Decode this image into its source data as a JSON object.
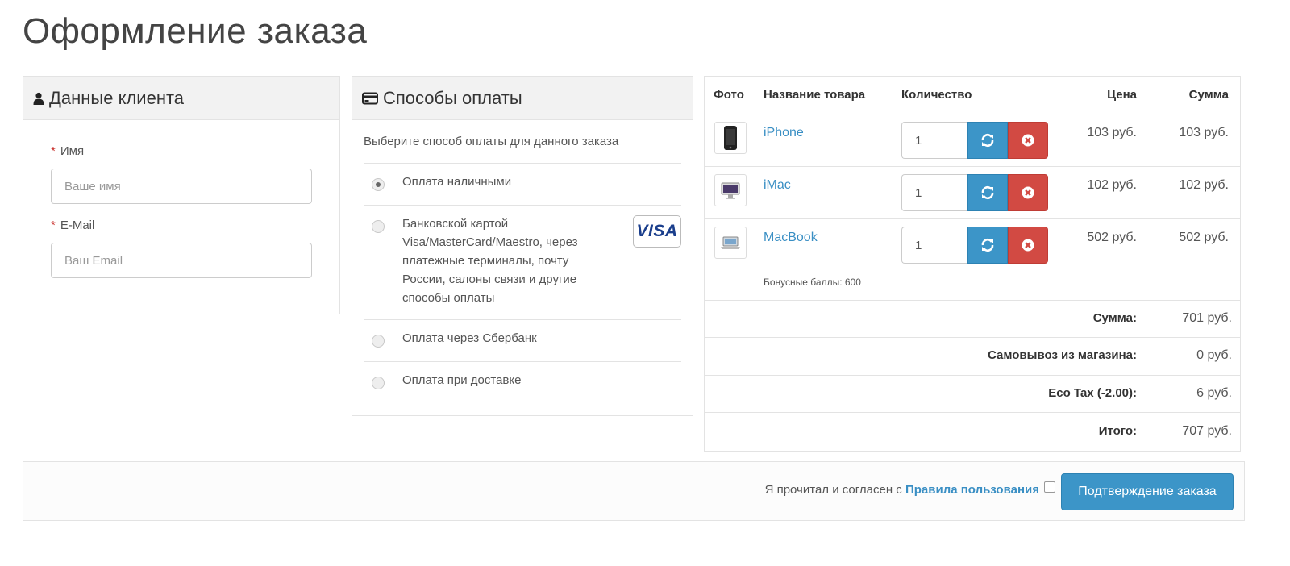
{
  "page": {
    "title": "Оформление заказа"
  },
  "customer": {
    "heading": "Данные клиента",
    "name_label": "Имя",
    "name_placeholder": "Ваше имя",
    "email_label": "E-Mail",
    "email_placeholder": "Ваш Email",
    "required_mark": "*"
  },
  "payment": {
    "heading": "Способы оплаты",
    "hint": "Выберите способ оплаты для данного заказа",
    "options": [
      {
        "label": "Оплата наличными",
        "selected": true
      },
      {
        "label": "Банковской картой Visa/MasterCard/Maestro, через платежные терминалы, почту России, салоны связи и другие способы оплаты",
        "selected": false,
        "badge": "VISA"
      },
      {
        "label": "Оплата через Сбербанк",
        "selected": false
      },
      {
        "label": "Оплата при доставке",
        "selected": false
      }
    ]
  },
  "cart": {
    "headers": {
      "photo": "Фото",
      "name": "Название товара",
      "qty": "Количество",
      "price": "Цена",
      "sum": "Сумма"
    },
    "items": [
      {
        "name": "iPhone",
        "qty": "1",
        "price": "103 руб.",
        "sum": "103 руб.",
        "icon": "iphone-icon"
      },
      {
        "name": "iMac",
        "qty": "1",
        "price": "102 руб.",
        "sum": "102 руб.",
        "icon": "imac-icon"
      },
      {
        "name": "MacBook",
        "qty": "1",
        "price": "502 руб.",
        "sum": "502 руб.",
        "icon": "macbook-icon"
      }
    ],
    "bonus": "Бонусные баллы: 600",
    "totals": [
      {
        "label": "Сумма:",
        "value": "701 руб."
      },
      {
        "label": "Самовывоз из магазина:",
        "value": "0 руб."
      },
      {
        "label": "Eco Tax (-2.00):",
        "value": "6 руб."
      },
      {
        "label": "Итого:",
        "value": "707 руб."
      }
    ]
  },
  "footer": {
    "agree_text": "Я прочитал и согласен с",
    "agree_link": "Правила пользования",
    "agree_checked": false,
    "confirm_label": "Подтверждение заказа"
  },
  "colors": {
    "accent": "#3c95c8",
    "danger": "#d24a43",
    "link": "#3a8fc4",
    "required": "#c9302c"
  }
}
